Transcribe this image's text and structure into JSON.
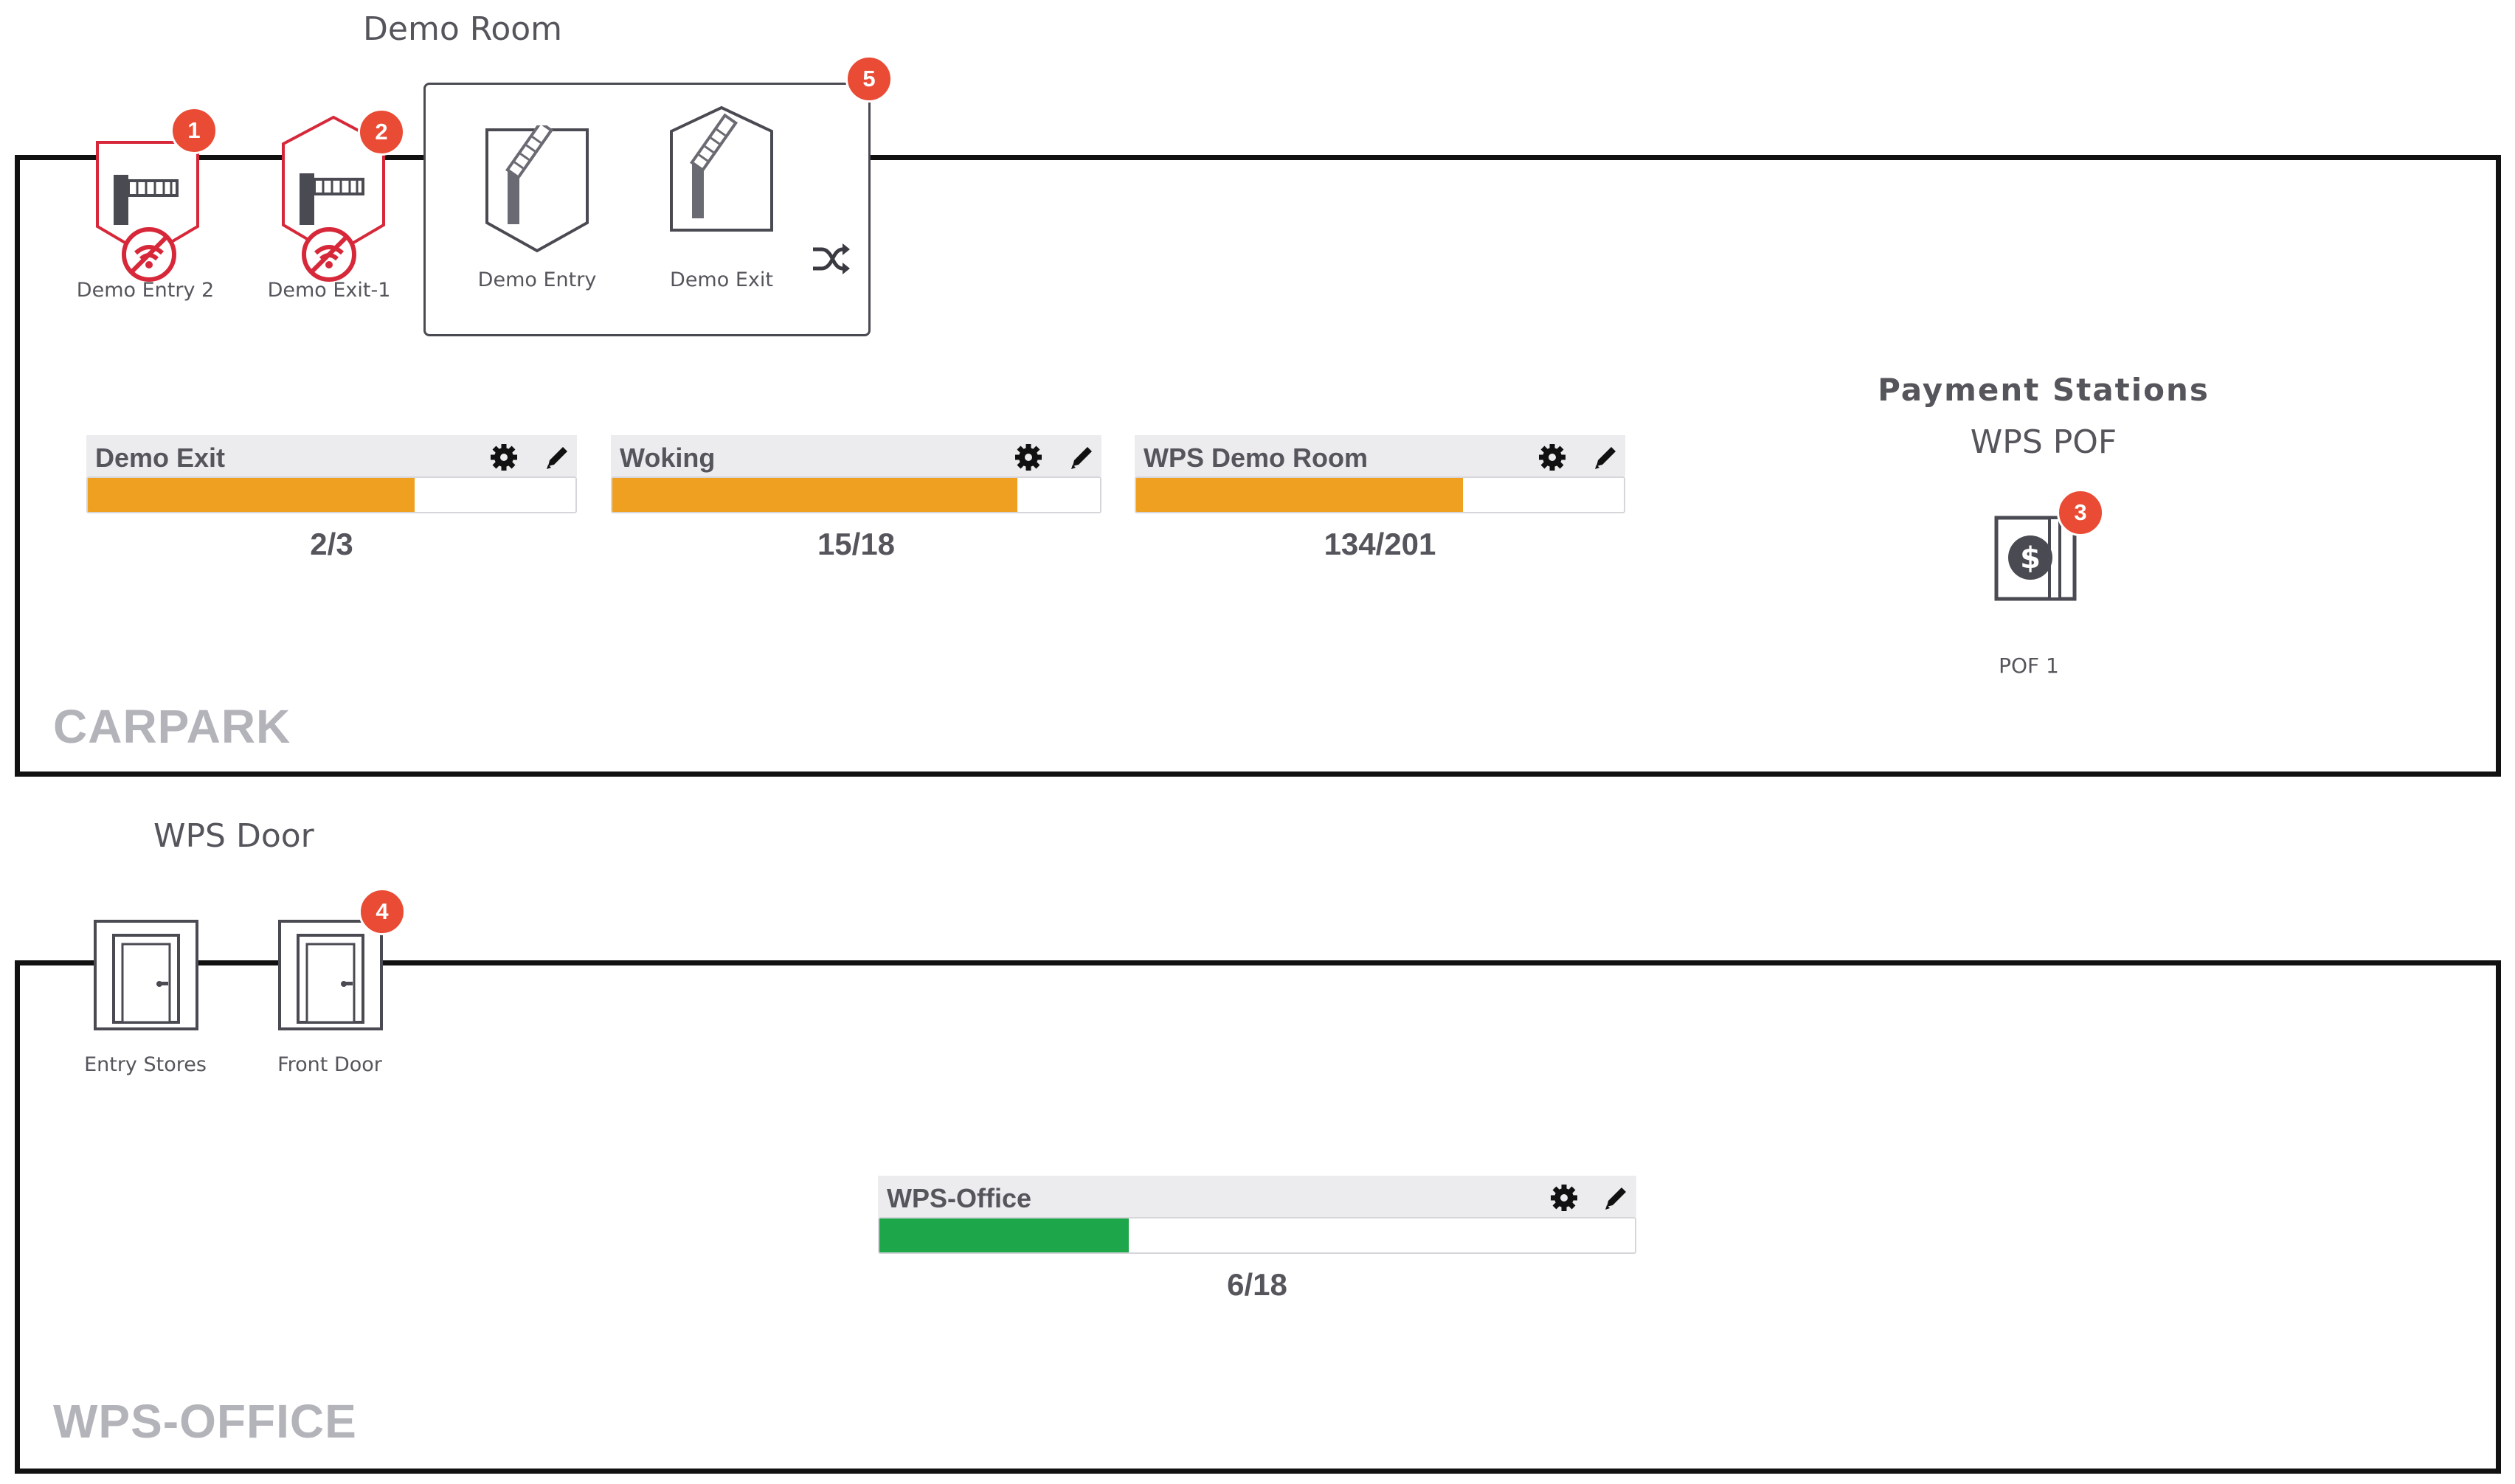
{
  "carpark": {
    "zone_label": "CARPARK",
    "group_title": "Demo Room",
    "devices": [
      {
        "label": "Demo Entry 2",
        "badge": "1",
        "status": "offline",
        "icon": "barrier-icon"
      },
      {
        "label": "Demo Exit-1",
        "badge": "2",
        "status": "offline",
        "icon": "barrier-icon"
      }
    ],
    "lane_group": {
      "badge": "5",
      "devices": [
        {
          "label": "Demo Entry",
          "icon": "barrier-arm-icon"
        },
        {
          "label": "Demo Exit",
          "icon": "barrier-arm-icon"
        }
      ],
      "shuffle_icon": "shuffle-icon"
    },
    "occupancy": [
      {
        "name": "Demo Exit",
        "count": "2/3",
        "current": 2,
        "max": 3,
        "fill_fraction": 0.67,
        "color": "#f0a020"
      },
      {
        "name": "Woking",
        "count": "15/18",
        "current": 15,
        "max": 18,
        "fill_fraction": 0.83,
        "color": "#f0a020"
      },
      {
        "name": "WPS Demo Room",
        "count": "134/201",
        "current": 134,
        "max": 201,
        "fill_fraction": 0.67,
        "color": "#f0a020"
      }
    ],
    "payment": {
      "heading": "Payment Stations",
      "subheading": "WPS POF",
      "device_label": "POF 1",
      "badge": "3",
      "icon": "payment-station-icon"
    }
  },
  "office": {
    "zone_label": "WPS-OFFICE",
    "group_title": "WPS Door",
    "devices": [
      {
        "label": "Entry Stores",
        "icon": "door-icon",
        "badge": ""
      },
      {
        "label": "Front Door",
        "icon": "door-icon",
        "badge": "4"
      }
    ],
    "occupancy": [
      {
        "name": "WPS-Office",
        "count": "6/18",
        "current": 6,
        "max": 18,
        "fill_fraction": 0.33,
        "color": "#1ea64a"
      }
    ]
  },
  "colors": {
    "alert": "#e94b35",
    "offline": "#d7283a",
    "icon_gray": "#4a4a52",
    "zone_border": "#111111"
  }
}
